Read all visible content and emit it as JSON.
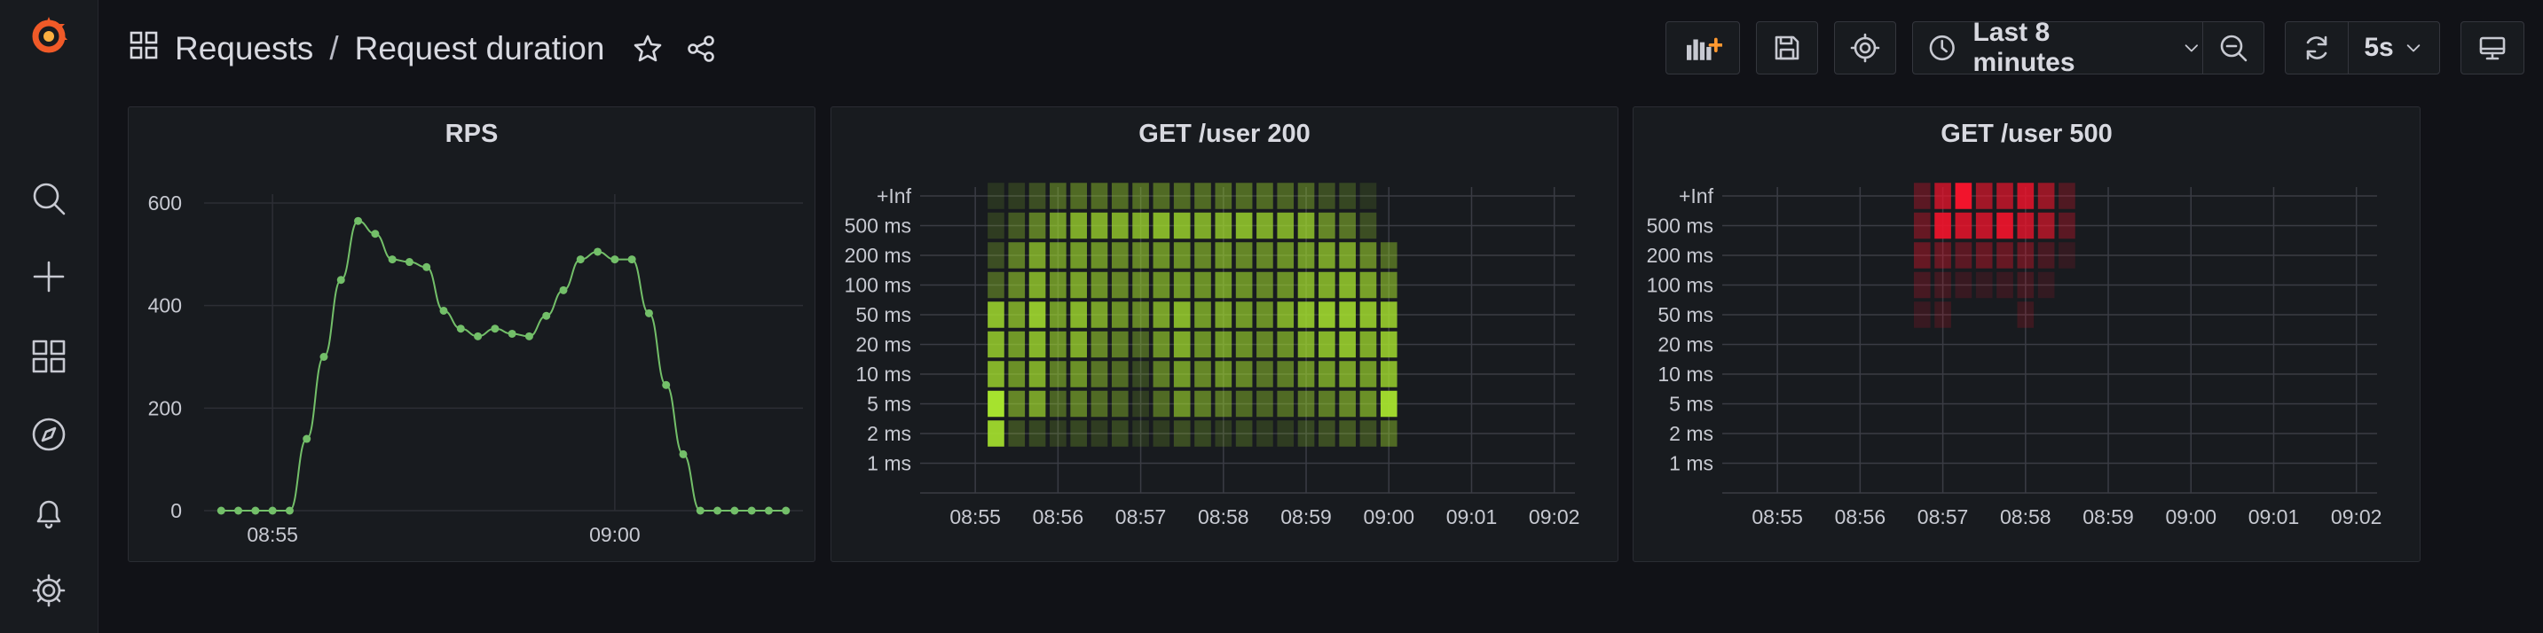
{
  "breadcrumb": {
    "folder": "Requests",
    "separator": "/",
    "dashboard": "Request duration"
  },
  "toolbar": {
    "time_range": "Last 8 minutes",
    "refresh_interval": "5s"
  },
  "colors": {
    "background": "#111217",
    "panel": "#181b1f",
    "line": "#73bf69",
    "heat_ok": "#a6e22e",
    "heat_err": "#f2142c",
    "logo": "#f05a28"
  },
  "panels": [
    {
      "title": "RPS"
    },
    {
      "title": "GET /user 200"
    },
    {
      "title": "GET /user 500"
    }
  ],
  "chart_data": [
    {
      "type": "line",
      "title": "RPS",
      "x_ticks": [
        "08:55",
        "09:00"
      ],
      "y_ticks": [
        "0",
        "200",
        "400",
        "600"
      ],
      "ylim": [
        0,
        600
      ],
      "grid": true,
      "x": [
        "08:54:15",
        "08:54:30",
        "08:54:45",
        "08:55:00",
        "08:55:15",
        "08:55:30",
        "08:55:45",
        "08:56:00",
        "08:56:15",
        "08:56:30",
        "08:56:45",
        "08:57:00",
        "08:57:15",
        "08:57:30",
        "08:57:45",
        "08:58:00",
        "08:58:15",
        "08:58:30",
        "08:58:45",
        "08:59:00",
        "08:59:15",
        "08:59:30",
        "08:59:45",
        "09:00:00",
        "09:00:15",
        "09:00:30",
        "09:00:45",
        "09:01:00",
        "09:01:15",
        "09:01:30",
        "09:01:45",
        "09:02:00",
        "09:02:15",
        "09:02:30"
      ],
      "series": [
        {
          "values": [
            0,
            0,
            0,
            0,
            0,
            140,
            300,
            450,
            565,
            540,
            490,
            485,
            475,
            390,
            355,
            340,
            355,
            345,
            340,
            380,
            430,
            490,
            505,
            490,
            490,
            385,
            245,
            110,
            0,
            0,
            0,
            0,
            0,
            0
          ]
        }
      ]
    },
    {
      "type": "heatmap",
      "title": "GET /user 200",
      "y_buckets": [
        "1 ms",
        "2 ms",
        "5 ms",
        "10 ms",
        "20 ms",
        "50 ms",
        "100 ms",
        "200 ms",
        "500 ms",
        "+Inf"
      ],
      "x_ticks": [
        "08:55",
        "08:56",
        "08:57",
        "08:58",
        "08:59",
        "09:00",
        "09:01",
        "09:02"
      ],
      "x": [
        "08:55:15",
        "08:55:30",
        "08:55:45",
        "08:56:00",
        "08:56:15",
        "08:56:30",
        "08:56:45",
        "08:57:00",
        "08:57:15",
        "08:57:30",
        "08:57:45",
        "08:58:00",
        "08:58:15",
        "08:58:30",
        "08:58:45",
        "08:59:00",
        "08:59:15",
        "08:59:30",
        "08:59:45",
        "09:00:00"
      ],
      "intensity_rows": [
        {
          "bucket": "2 ms",
          "values": [
            0.9,
            0.2,
            0.15,
            0.1,
            0.15,
            0.1,
            0.15,
            0.05,
            0.1,
            0.2,
            0.15,
            0.1,
            0.15,
            0.1,
            0.1,
            0.15,
            0.2,
            0.25,
            0.2,
            0.35
          ]
        },
        {
          "bucket": "5 ms",
          "values": [
            1.0,
            0.5,
            0.65,
            0.3,
            0.45,
            0.35,
            0.3,
            0.1,
            0.35,
            0.55,
            0.45,
            0.4,
            0.35,
            0.3,
            0.35,
            0.4,
            0.45,
            0.5,
            0.55,
            0.95
          ]
        },
        {
          "bucket": "10 ms",
          "values": [
            0.75,
            0.55,
            0.7,
            0.45,
            0.55,
            0.4,
            0.35,
            0.15,
            0.45,
            0.6,
            0.5,
            0.55,
            0.5,
            0.4,
            0.45,
            0.55,
            0.6,
            0.65,
            0.6,
            0.75
          ]
        },
        {
          "bucket": "20 ms",
          "values": [
            0.75,
            0.6,
            0.75,
            0.55,
            0.7,
            0.5,
            0.45,
            0.3,
            0.55,
            0.7,
            0.55,
            0.6,
            0.55,
            0.5,
            0.55,
            0.7,
            0.75,
            0.8,
            0.7,
            0.8
          ]
        },
        {
          "bucket": "50 ms",
          "values": [
            0.8,
            0.65,
            0.85,
            0.6,
            0.75,
            0.65,
            0.55,
            0.5,
            0.65,
            0.75,
            0.6,
            0.65,
            0.6,
            0.55,
            0.7,
            0.8,
            0.85,
            0.85,
            0.8,
            0.8
          ]
        },
        {
          "bucket": "100 ms",
          "values": [
            0.3,
            0.5,
            0.7,
            0.55,
            0.65,
            0.55,
            0.5,
            0.5,
            0.55,
            0.6,
            0.55,
            0.6,
            0.55,
            0.5,
            0.55,
            0.7,
            0.7,
            0.75,
            0.65,
            0.5
          ]
        },
        {
          "bucket": "200 ms",
          "values": [
            0.2,
            0.45,
            0.65,
            0.55,
            0.6,
            0.55,
            0.5,
            0.5,
            0.55,
            0.55,
            0.5,
            0.55,
            0.5,
            0.5,
            0.55,
            0.6,
            0.65,
            0.65,
            0.5,
            0.35
          ]
        },
        {
          "bucket": "500 ms",
          "values": [
            0.1,
            0.25,
            0.45,
            0.6,
            0.7,
            0.7,
            0.7,
            0.7,
            0.75,
            0.75,
            0.7,
            0.7,
            0.75,
            0.7,
            0.7,
            0.7,
            0.5,
            0.4,
            0.2,
            0.0
          ]
        },
        {
          "bucket": "+Inf",
          "values": [
            0.05,
            0.1,
            0.2,
            0.3,
            0.35,
            0.35,
            0.35,
            0.35,
            0.35,
            0.35,
            0.35,
            0.35,
            0.35,
            0.35,
            0.3,
            0.3,
            0.2,
            0.15,
            0.05,
            0.0
          ]
        }
      ]
    },
    {
      "type": "heatmap",
      "title": "GET /user 500",
      "y_buckets": [
        "1 ms",
        "2 ms",
        "5 ms",
        "10 ms",
        "20 ms",
        "50 ms",
        "100 ms",
        "200 ms",
        "500 ms",
        "+Inf"
      ],
      "x_ticks": [
        "08:55",
        "08:56",
        "08:57",
        "08:58",
        "08:59",
        "09:00",
        "09:01",
        "09:02"
      ],
      "x": [
        "08:56:45",
        "08:57:00",
        "08:57:15",
        "08:57:30",
        "08:57:45",
        "08:58:00",
        "08:58:15",
        "08:58:30"
      ],
      "intensity_rows": [
        {
          "bucket": "50 ms",
          "values": [
            0.08,
            0.1,
            0.0,
            0.0,
            0.0,
            0.1,
            0.0,
            0.0
          ]
        },
        {
          "bucket": "100 ms",
          "values": [
            0.15,
            0.12,
            0.08,
            0.05,
            0.08,
            0.12,
            0.05,
            0.0
          ]
        },
        {
          "bucket": "200 ms",
          "values": [
            0.3,
            0.3,
            0.25,
            0.3,
            0.3,
            0.3,
            0.15,
            0.05
          ]
        },
        {
          "bucket": "500 ms",
          "values": [
            0.3,
            0.9,
            0.8,
            0.75,
            0.9,
            0.75,
            0.6,
            0.25
          ]
        },
        {
          "bucket": "+Inf",
          "values": [
            0.25,
            0.7,
            1.0,
            0.6,
            0.65,
            0.8,
            0.55,
            0.2
          ]
        }
      ]
    }
  ]
}
